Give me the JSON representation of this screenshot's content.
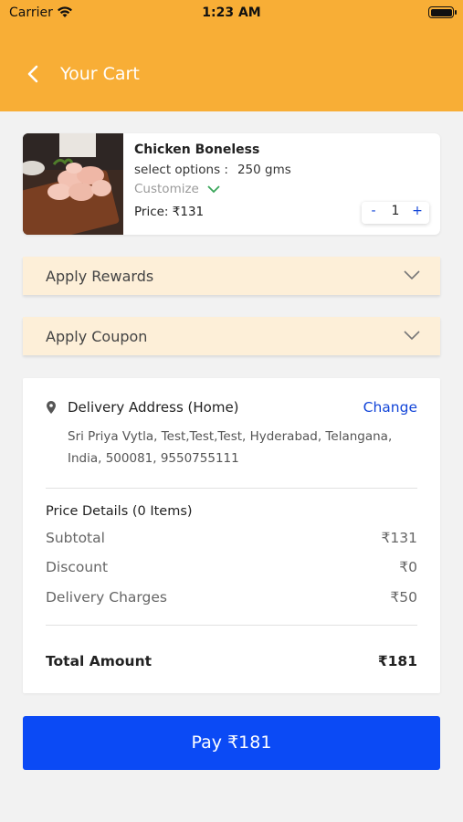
{
  "status_bar": {
    "carrier": "Carrier",
    "time": "1:23 AM"
  },
  "header": {
    "title": "Your Cart"
  },
  "cart_item": {
    "name": "Chicken Boneless",
    "options_label": "select options :",
    "options_value": "250 gms",
    "customize_label": "Customize",
    "price": "Price: ₹131",
    "quantity": "1",
    "minus": "-",
    "plus": "+"
  },
  "rewards": {
    "label": "Apply Rewards"
  },
  "coupon": {
    "label": "Apply Coupon"
  },
  "delivery": {
    "title": "Delivery Address (Home)",
    "change_label": "Change",
    "address": "Sri Priya Vytla, Test,Test,Test, Hyderabad, Telangana, India, 500081, 9550755111"
  },
  "price_details": {
    "title": "Price Details (0 Items)",
    "rows": [
      {
        "label": "Subtotal",
        "value": "₹131"
      },
      {
        "label": "Discount",
        "value": "₹0"
      },
      {
        "label": "Delivery Charges",
        "value": "₹50"
      }
    ],
    "total_label": "Total Amount",
    "total_value": "₹181"
  },
  "pay_button": {
    "label": "Pay ₹181"
  },
  "colors": {
    "header_bg": "#f8ae36",
    "accordion_bg": "#fdefd8",
    "accent_blue": "#0b4af5",
    "link_blue": "#1245d8",
    "check_green": "#3aa65a"
  },
  "icons": {
    "back": "chevron-left-icon",
    "customize": "chevron-down-icon",
    "accordion": "chevron-down-icon",
    "location": "location-pin-icon"
  }
}
